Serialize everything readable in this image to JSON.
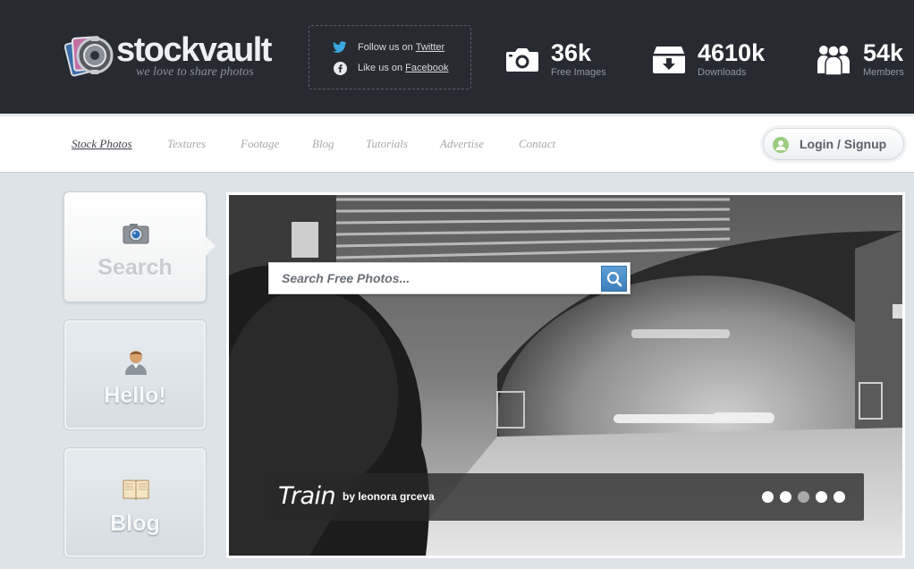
{
  "header": {
    "logo": {
      "name": "stockvault",
      "tagline": "we love to share photos"
    },
    "social": [
      {
        "prefix": "Follow us on",
        "link": "Twitter",
        "icon": "twitter-icon"
      },
      {
        "prefix": "Like us on",
        "link": "Facebook",
        "icon": "facebook-icon"
      }
    ],
    "stats": [
      {
        "value": "36k",
        "label": "Free Images",
        "icon": "camera-icon"
      },
      {
        "value": "4610k",
        "label": "Downloads",
        "icon": "download-box-icon"
      },
      {
        "value": "54k",
        "label": "Members",
        "icon": "members-icon"
      }
    ]
  },
  "nav": {
    "items": [
      "Stock Photos",
      "Textures",
      "Footage",
      "Blog",
      "Tutorials",
      "Advertise",
      "Contact"
    ],
    "active_index": 0,
    "login_label": "Login / Signup"
  },
  "sidebar": {
    "cards": [
      {
        "label": "Search",
        "icon": "camera-icon"
      },
      {
        "label": "Hello!",
        "icon": "user-icon"
      },
      {
        "label": "Blog",
        "icon": "book-icon"
      }
    ],
    "active_index": 0
  },
  "hero": {
    "search_placeholder": "Search Free Photos...",
    "caption_title": "Train",
    "caption_by": "by leonora grceva",
    "slide_count": 5,
    "active_slide": 2
  },
  "colors": {
    "header_bg": "#272a31",
    "page_bg": "#dde3e8",
    "search_button": "#4a8cc8"
  }
}
